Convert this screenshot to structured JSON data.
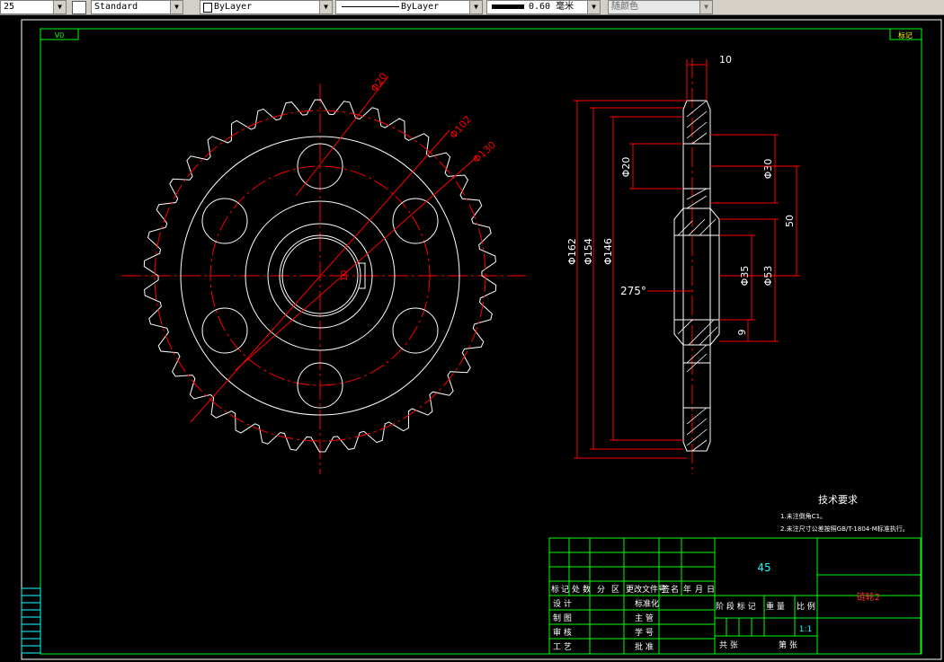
{
  "toolbar": {
    "textstyle_value": "25",
    "dimstyle_value": "Standard",
    "color_value": "ByLayer",
    "linetype_value": "ByLayer",
    "lineweight_value": "0.60 毫米",
    "plotstyle_value": "随颜色"
  },
  "frame": {
    "top_left_tag": "V0",
    "top_right_tag": "标记"
  },
  "dimensions": {
    "phi20_front": "Φ20",
    "phi102": "Φ102",
    "phi130": "Φ130",
    "key_width": "10",
    "hub_width": "10",
    "phi162": "Φ162",
    "phi154": "Φ154",
    "phi146": "Φ146",
    "phi20_side": "Φ20",
    "phi30": "Φ30",
    "dim50": "50",
    "phi35": "Φ35",
    "phi53": "Φ53",
    "dim9": "9",
    "angle": "275°"
  },
  "tech_requirements": {
    "title": "技术要求",
    "line1": "1.未注倒角C1。",
    "line2": "2.未注尺寸公差按照GB/T-1804-M标准执行。"
  },
  "title_block": {
    "material": "45",
    "drawing_name": "链轮2",
    "scale": "1:1",
    "row_header": [
      "标",
      "记",
      "处",
      "数",
      "分",
      "区",
      "更改文件号",
      "签",
      "名",
      "年",
      "月",
      "日"
    ],
    "design": "设 计",
    "draw": "制 图",
    "review": "审 核",
    "craft": "工 艺",
    "standardize": "标准化",
    "approve_group": "主 管",
    "student_no": "学 号",
    "approve": "批 准",
    "stage_label": "阶 段 标 记",
    "weight_label": "重 量",
    "scale_label": "比 例",
    "sheets_total": "共    张",
    "sheet_no": "第    张"
  }
}
